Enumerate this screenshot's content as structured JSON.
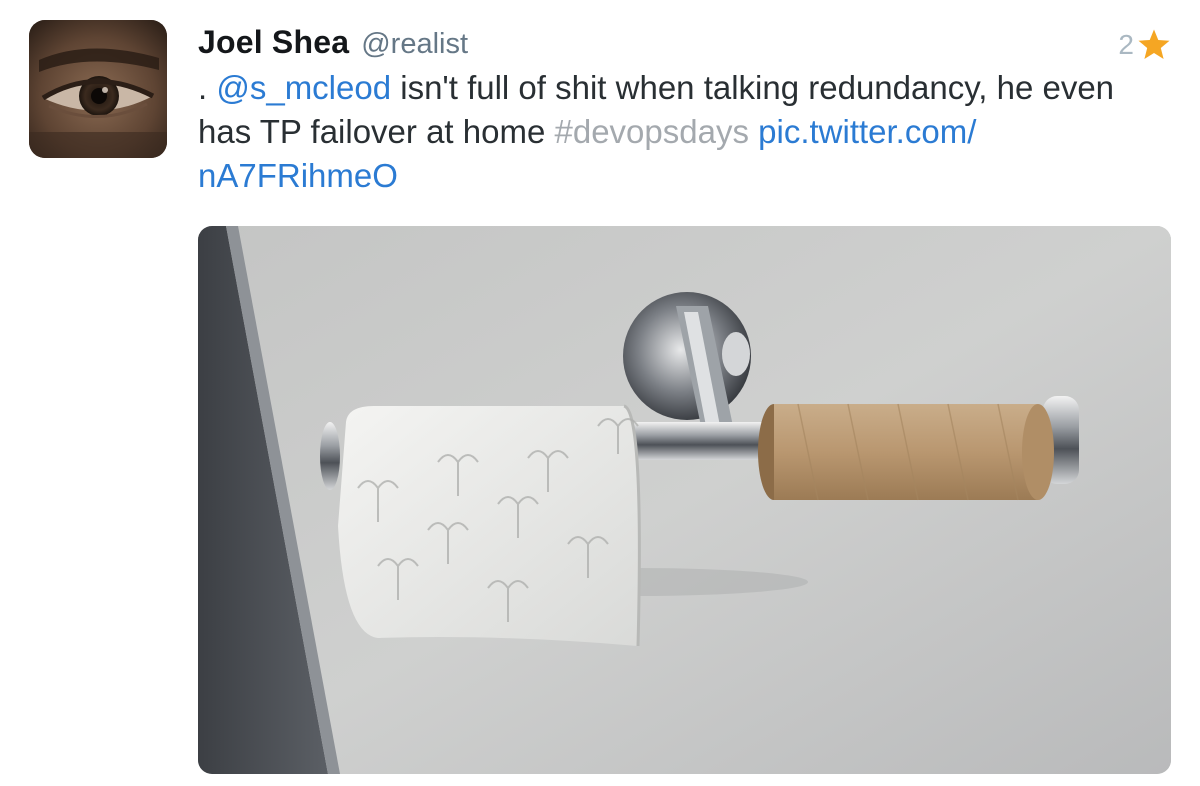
{
  "tweet": {
    "author": {
      "display_name": "Joel Shea",
      "handle": "@realist",
      "avatar_icon": "avatar-eye-closeup"
    },
    "favorite_count": "2",
    "favorite_icon": "star-icon",
    "favorite_color": "#f5a623",
    "text": {
      "prefix": ". ",
      "mention": "@s_mcleod",
      "body": " isn't full of shit when talking redundancy, he even has TP failover at home ",
      "hashtag": "#devopsdays",
      "space": " ",
      "link_line1": "pic.twitter.com/",
      "link_line2": "nA7FRihmeO"
    },
    "colors": {
      "mention": "#2b7bd3",
      "hashtag": "#a4a9ae",
      "link": "#2b7bd3"
    },
    "media": {
      "type": "photo",
      "subject": "toilet-paper-holder"
    }
  }
}
